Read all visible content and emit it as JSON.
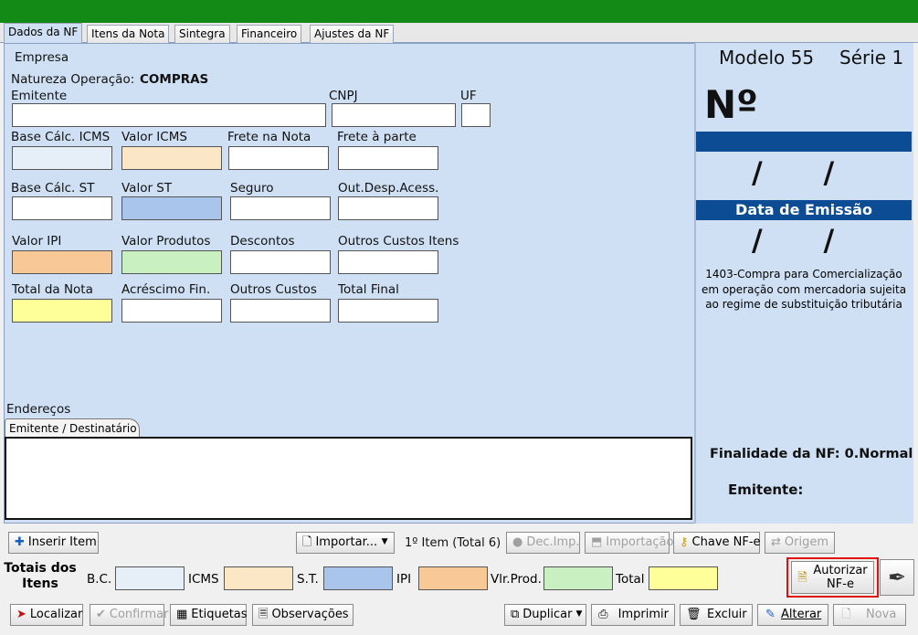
{
  "tabs": [
    {
      "label": "Dados da NF",
      "active": true
    },
    {
      "label": "Itens da Nota",
      "active": false
    },
    {
      "label": "Sintegra",
      "active": false
    },
    {
      "label": "Financeiro",
      "active": false
    },
    {
      "label": "Ajustes da NF",
      "active": false
    }
  ],
  "form": {
    "empresa_label": "Empresa",
    "natureza_label": "Natureza Operação:",
    "natureza_value": "COMPRAS",
    "emitente_label": "Emitente",
    "cnpj_label": "CNPJ",
    "uf_label": "UF",
    "base_icms_label": "Base Cálc. ICMS",
    "valor_icms_label": "Valor ICMS",
    "frete_nota_label": "Frete na Nota",
    "frete_parte_label": "Frete à parte",
    "base_st_label": "Base Cálc. ST",
    "valor_st_label": "Valor ST",
    "seguro_label": "Seguro",
    "out_desp_label": "Out.Desp.Acess.",
    "valor_ipi_label": "Valor IPI",
    "valor_produtos_label": "Valor Produtos",
    "descontos_label": "Descontos",
    "outros_custos_itens_label": "Outros Custos Itens",
    "total_nota_label": "Total da Nota",
    "acrescimo_label": "Acréscimo Fin.",
    "outros_custos_label": "Outros Custos",
    "total_final_label": "Total Final",
    "enderecos_label": "Endereços",
    "endereco_tab": "Emitente / Destinatário"
  },
  "right": {
    "modelo": "Modelo 55",
    "serie": "Série 1",
    "numero_label": "Nº",
    "date_slashes": "/      /",
    "data_emissao": "Data de Emissão",
    "date_slashes2": "/      /",
    "cfop_desc": "1403-Compra para Comercialização em operação com mercadoria sujeita ao regime de substituição tributária",
    "finalidade": "Finalidade da NF: 0.Normal",
    "emitente": "Emitente:"
  },
  "toolbar1": {
    "inserir": "Inserir Item",
    "importar": "Importar...",
    "item_count": "1º Item (Total 6)",
    "dec_imp": "Dec.Imp.",
    "importacao": "Importação",
    "chave": "Chave NF-e",
    "origem": "Origem"
  },
  "totais": {
    "title": "Totais dos Itens",
    "bc": "B.C.",
    "icms": "ICMS",
    "st": "S.T.",
    "ipi": "IPI",
    "vlr_prod": "Vlr.Prod.",
    "total": "Total",
    "autorizar": "Autorizar NF-e"
  },
  "toolbar2": {
    "localizar": "Localizar",
    "confirmar": "Confirmar",
    "etiquetas": "Etiquetas",
    "observacoes": "Observações",
    "duplicar": "Duplicar",
    "imprimir": "Imprimir",
    "excluir": "Excluir",
    "alterar": "Alterar",
    "nova": "Nova"
  },
  "colors": {
    "title_green": "#138a16",
    "panel_bg": "#cfe0f4",
    "bar_blue": "#0c4c94",
    "valor_icms": "#fbe7c6",
    "valor_st": "#a9c5ec",
    "valor_ipi": "#f8c896",
    "valor_produtos": "#c8f0c0",
    "total_nota": "#ffff99",
    "highlight_red": "#e01010"
  }
}
